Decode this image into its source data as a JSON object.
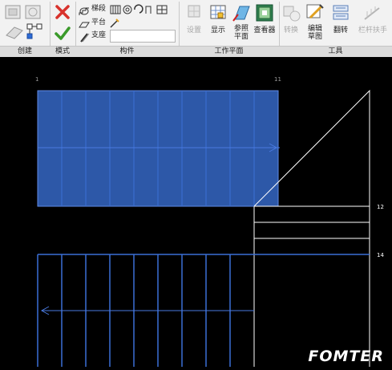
{
  "ribbon": {
    "panels": {
      "create": "创建",
      "mode": "模式",
      "draw": "构件",
      "workplane": "工作平面",
      "tools": "工具"
    },
    "draw_items": {
      "run": "梯段",
      "landing": "平台",
      "support": "支座"
    },
    "workplane_buttons": {
      "set": "设置",
      "show": "显示",
      "ref_plane_line1": "参照",
      "ref_plane_line2": "平面",
      "viewer": "查看器"
    },
    "tools_buttons": {
      "convert": "转换",
      "edit_sketch_line1": "编辑",
      "edit_sketch_line2": "草图",
      "flip": "翻转",
      "railing": "栏杆扶手"
    }
  },
  "canvas": {
    "grid_labels": {
      "top_left": "1",
      "top_right": "11",
      "right_12": "12",
      "right_14": "14"
    },
    "colors": {
      "run_fill": "#2d58a8",
      "run_line": "#3b6fd6",
      "sketch_line": "#ffffff",
      "background": "#000000"
    }
  },
  "watermark": "FOMTER"
}
